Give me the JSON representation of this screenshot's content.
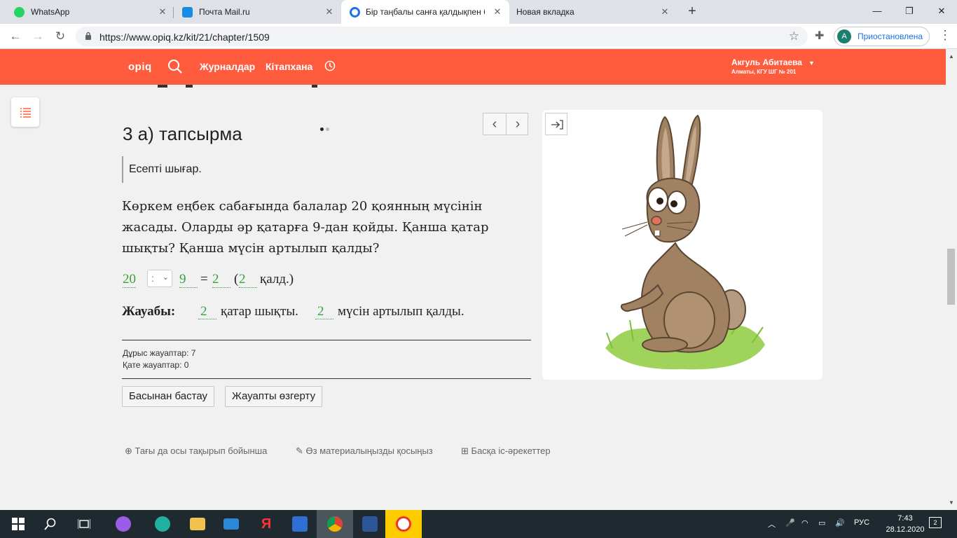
{
  "browser": {
    "tabs": [
      {
        "title": "WhatsApp",
        "color": "#25d366"
      },
      {
        "title": "Почта Mail.ru",
        "color": "#168de2"
      },
      {
        "title": "Бір таңбалы санға қалдықпен б",
        "color": "#1a73e8"
      },
      {
        "title": "Новая вкладка",
        "color": ""
      }
    ],
    "url": "https://www.opiq.kz/kit/21/chapter/1509",
    "profile_initial": "A",
    "profile_label": "Приостановлена"
  },
  "site": {
    "logo": "opiq",
    "nav": [
      "Журналдар",
      "Кітапхана"
    ],
    "user_name": "Акгуль Абитаева",
    "user_school": "Алматы, КГУ ШГ № 201",
    "accent": "#ff5c3e"
  },
  "task": {
    "title": "3 а) тапсырма",
    "instruction": "Есепті шығар.",
    "problem": "Көркем еңбек сабағында балалар 20 қоянның мүсінін жасады. Оларды әр қатарға 9-дан қойды. Қанша қатар шықты? Қанша мүсін артылып қалды?",
    "equation": {
      "a": "20",
      "op": ":",
      "b": "9",
      "eq": "=",
      "q": "2",
      "open": "(",
      "r": "2",
      "rest": "қалд.)"
    },
    "answer": {
      "label": "Жауабы:",
      "rows": "2",
      "rows_text": "қатар шықты.",
      "left": "2",
      "left_text": "мүсін артылып қалды."
    },
    "correct": "Дұрыс жауаптар: 7",
    "wrong": "Қате жауаптар: 0",
    "restart_btn": "Басынан бастау",
    "change_btn": "Жауапты өзгерту"
  },
  "footer_links": [
    "Тағы да осы тақырып бойынша",
    "Өз материалыңызды қосыңыз",
    "Басқа іс-әрекеттер"
  ],
  "taskbar": {
    "lang": "РУС",
    "time": "7:43",
    "date": "28.12.2020",
    "notifications": "2"
  }
}
